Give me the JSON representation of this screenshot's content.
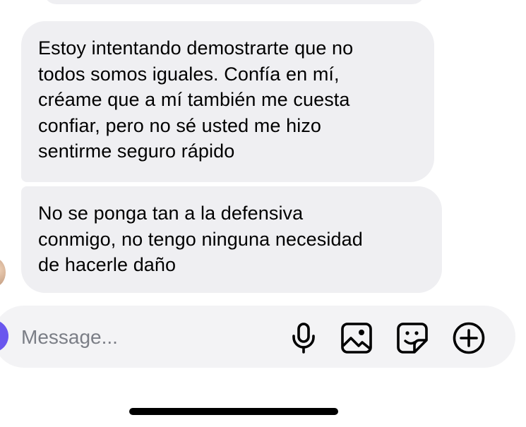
{
  "messages": [
    {
      "text": "Estoy intentando demostrarte que no\ntodos somos iguales. Confía en mí,\ncréame que a mí también me cuesta\nconfiar, pero no sé usted me hizo\nsentirme seguro rápido"
    },
    {
      "text": "No se ponga tan a la defensiva\nconmigo, no tengo ninguna necesidad\nde hacerle daño"
    }
  ],
  "composer": {
    "placeholder": "Message...",
    "icons": [
      "microphone-icon",
      "photo-icon",
      "sticker-icon",
      "add-circle-icon"
    ]
  },
  "colors": {
    "bubble_bg": "#efeff2",
    "composer_bg": "#f3f3f5",
    "accent": "#6a57ee",
    "placeholder": "#7b7e86",
    "text": "#000000"
  }
}
